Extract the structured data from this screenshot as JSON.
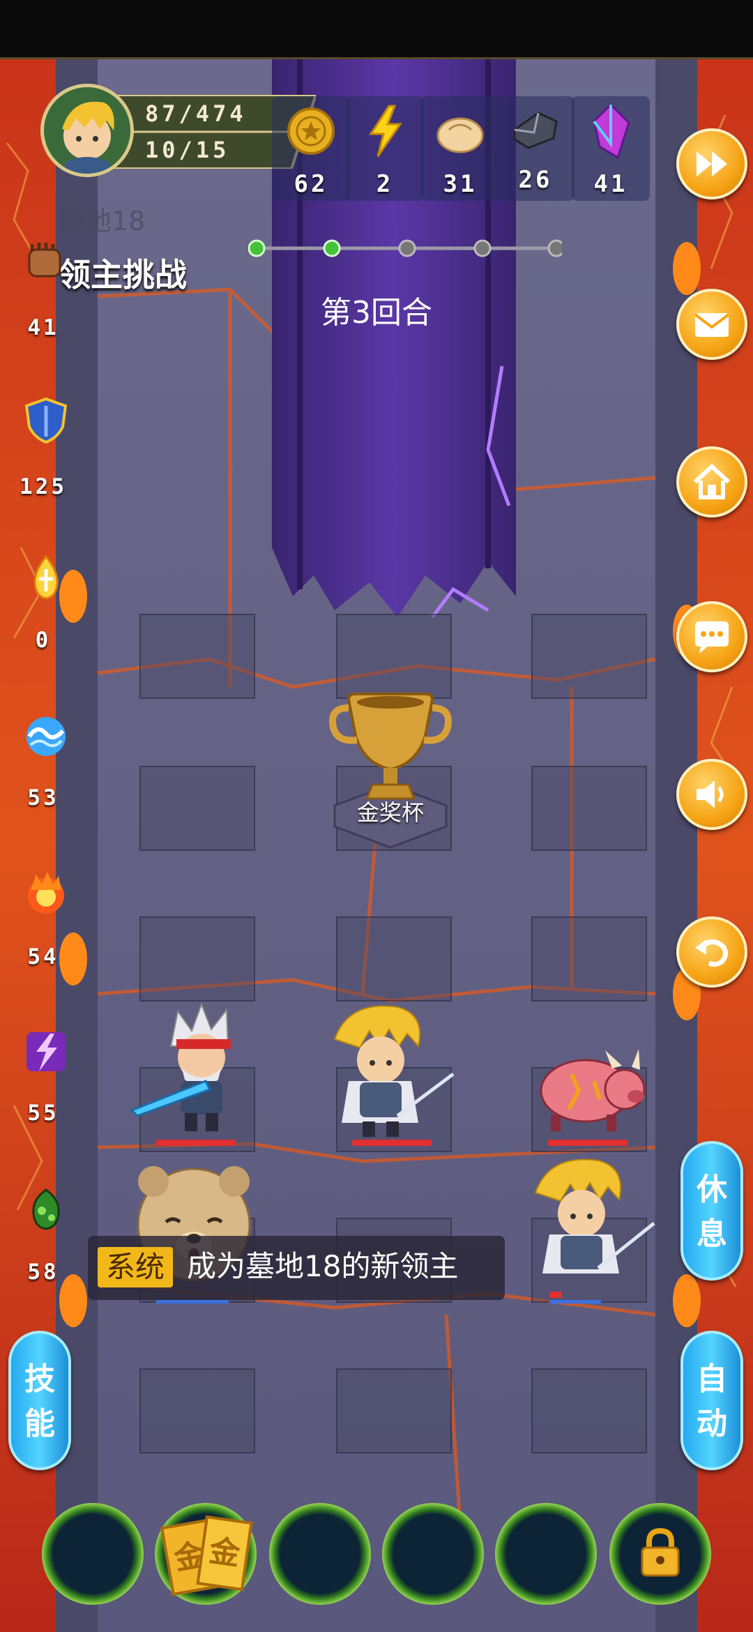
{
  "player": {
    "hp": "87/474",
    "level": "10/15"
  },
  "resources": [
    {
      "icon": "gold-coin-icon",
      "value": "62"
    },
    {
      "icon": "lightning-icon",
      "value": "2"
    },
    {
      "icon": "bun-icon",
      "value": "31"
    },
    {
      "icon": "iron-ore-icon",
      "value": "26"
    },
    {
      "icon": "crystal-icon",
      "value": "41"
    }
  ],
  "area_name": "墓地18",
  "mode_title": "领主挑战",
  "round_text": "第3回合",
  "round_progress": {
    "total": 5,
    "completed": 2
  },
  "stats": [
    {
      "icon": "fist-icon",
      "value": "41"
    },
    {
      "icon": "shield-icon",
      "value": "125"
    },
    {
      "icon": "holy-flame-icon",
      "value": "0"
    },
    {
      "icon": "water-wave-icon",
      "value": "53"
    },
    {
      "icon": "fire-orb-icon",
      "value": "54"
    },
    {
      "icon": "lightning-rune-icon",
      "value": "55"
    },
    {
      "icon": "poison-icon",
      "value": "58"
    }
  ],
  "trophy_label": "金奖杯",
  "system_message": {
    "tag": "系统",
    "text": "成为墓地18的新领主"
  },
  "right_buttons": [
    "fast-forward-icon",
    "mail-icon",
    "home-icon",
    "chat-icon",
    "sound-icon",
    "back-icon"
  ],
  "rest_button": "休息",
  "auto_button": "自动",
  "skill_button": "技能",
  "gold_card_text": "金",
  "colors": {
    "accent_orange": "#f6a415",
    "pill_blue": "#23a9ef",
    "lava": "#d8461a",
    "banner_purple": "#4b2d8c"
  }
}
